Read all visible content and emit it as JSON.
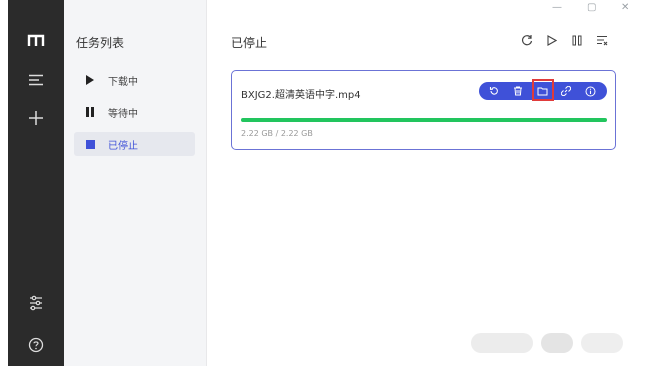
{
  "tasklist": {
    "title": "任务列表",
    "items": [
      {
        "label": "下载中",
        "icon": "play-icon",
        "active": false
      },
      {
        "label": "等待中",
        "icon": "pause-icon",
        "active": false
      },
      {
        "label": "已停止",
        "icon": "stop-icon",
        "active": true
      }
    ]
  },
  "main": {
    "title": "已停止",
    "header_actions": [
      "refresh-icon",
      "play-icon",
      "pause-all-icon",
      "clear-list-icon"
    ]
  },
  "task": {
    "filename": "BXJG2.超清英语中字.mp4",
    "size_text": "2.22 GB / 2.22 GB",
    "progress_fraction": 1.0,
    "actions": [
      "restart-icon",
      "delete-icon",
      "open-folder-icon",
      "copy-link-icon",
      "info-icon"
    ],
    "highlighted_action": "open-folder-icon"
  },
  "colors": {
    "sidebar_dark": "#2b2b2b",
    "accent": "#3f51d8",
    "progress": "#22c55e",
    "highlight": "#e03b3b"
  }
}
